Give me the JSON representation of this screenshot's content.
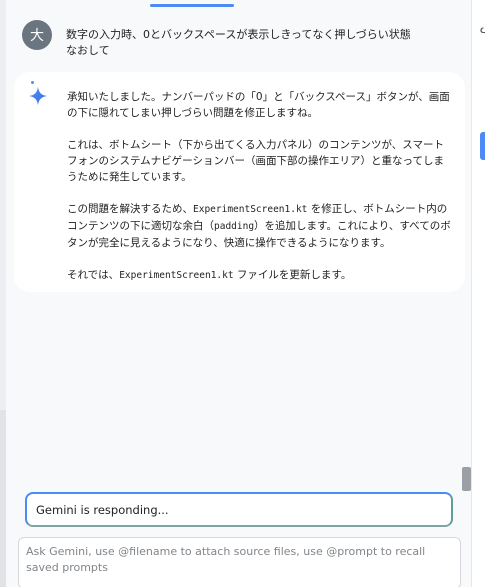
{
  "colors": {
    "accent": "#4c8bf5",
    "avatar_bg": "#6b7580",
    "card_bg": "#ffffff",
    "panel_bg": "#f8f9fb"
  },
  "user_message": {
    "avatar_initial": "大",
    "text": "数字の入力時、0とバックスペースが表示しきってなく押しづらい状態\nなおして"
  },
  "response": {
    "icon": "gemini-sparkle-icon",
    "p1": "承知いたしました。ナンバーパッドの「0」と「バックスペース」ボタンが、画面の下に隠れてしまい押しづらい問題を修正しますね。",
    "p2": "これは、ボトムシート（下から出てくる入力パネル）のコンテンツが、スマートフォンのシステムナビゲーションバー（画面下部の操作エリア）と重なってしまうために発生しています。",
    "p3_a": "この問題を解決するため、",
    "p3_code1": "ExperimentScreen1.kt",
    "p3_b": " を修正し、ボトムシート内のコンテンツの下に適切な余白（",
    "p3_code2": "padding",
    "p3_c": "）を追加します。これにより、すべてのボタンが完全に見えるようになり、快適に操作できるようになります。",
    "p4_a": "それでは、",
    "p4_code": "ExperimentScreen1.kt",
    "p4_b": " ファイルを更新します。"
  },
  "status": {
    "text": "Gemini is responding..."
  },
  "chat_input": {
    "placeholder": "Ask Gemini, use @filename to attach source files, use @prompt to recall saved prompts",
    "value": ""
  }
}
